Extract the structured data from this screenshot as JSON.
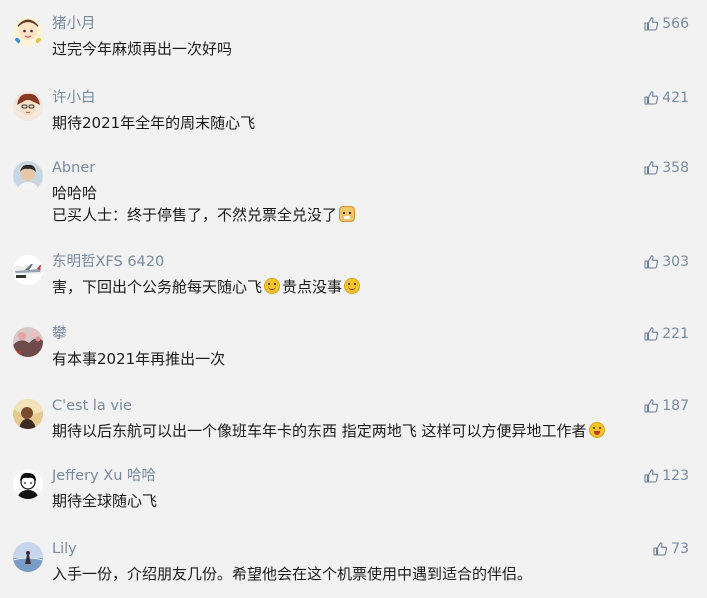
{
  "colors": {
    "background": "#f2f2f2",
    "name": "#7a8aa0",
    "text": "#1a1a1a",
    "like": "#7a8aa0"
  },
  "icons": {
    "like": "thumbs-up-icon"
  },
  "comments": [
    {
      "name": "猪小月",
      "lines": [
        [
          "过完今年麻烦再出一次好吗"
        ]
      ],
      "likes": "566"
    },
    {
      "name": "许小白",
      "lines": [
        [
          "期待2021年全年的周末随心飞"
        ]
      ],
      "likes": "421"
    },
    {
      "name": "Abner",
      "lines": [
        [
          "哈哈哈"
        ],
        [
          "已买人士：终于停售了，不然兑票全兑没了"
        ]
      ],
      "likes": "358",
      "emojis": [
        "doge-emoji"
      ]
    },
    {
      "name": "东明哲XFS 6420",
      "lines": [
        [
          "害，下回出个公务舱每天随心飞",
          "贵点没事"
        ]
      ],
      "likes": "303",
      "emojis": [
        "smile-emoji",
        "smile-emoji"
      ]
    },
    {
      "name": "攀",
      "lines": [
        [
          "有本事2021年再推出一次"
        ]
      ],
      "likes": "221"
    },
    {
      "name": "C'est la vie",
      "lines": [
        [
          "期待以后东航可以出一个像班车年卡的东西 指定两地飞 这样可以方便异地工作者"
        ]
      ],
      "likes": "187",
      "emojis": [
        "laugh-emoji"
      ]
    },
    {
      "name": "Jeffery Xu 哈哈",
      "lines": [
        [
          "期待全球随心飞"
        ]
      ],
      "likes": "123"
    },
    {
      "name": "Lily",
      "lines": [
        [
          "入手一份，介绍朋友几份。希望他会在这个机票使用中遇到适合的伴侣。"
        ]
      ],
      "likes": "73"
    }
  ]
}
